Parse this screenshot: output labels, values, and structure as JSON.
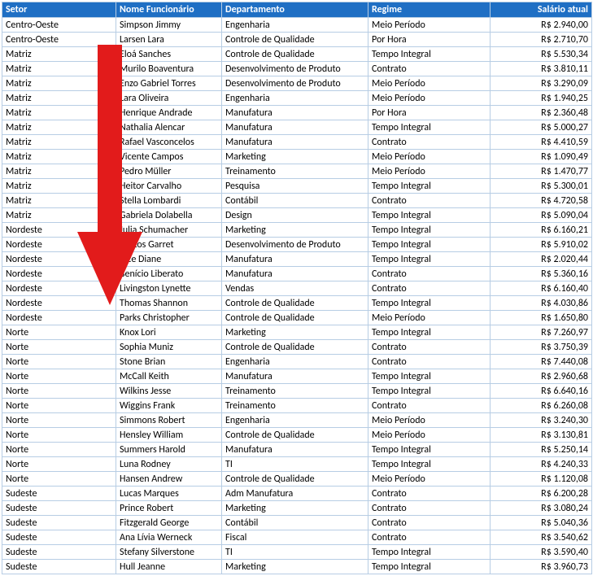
{
  "headers": {
    "setor": "Setor",
    "nome": "Nome Funcionário",
    "departamento": "Departamento",
    "regime": "Regime",
    "salario": "Salário atual"
  },
  "rows": [
    {
      "setor": "Centro-Oeste",
      "nome": "Simpson Jimmy",
      "departamento": "Engenharia",
      "regime": "Meio Período",
      "salario": "R$ 2.940,00"
    },
    {
      "setor": "Centro-Oeste",
      "nome": "Larsen Lara",
      "departamento": "Controle de Qualidade",
      "regime": "Por Hora",
      "salario": "R$ 2.710,70"
    },
    {
      "setor": "Matriz",
      "nome": "Eloá Sanches",
      "departamento": "Controle de Qualidade",
      "regime": "Tempo Integral",
      "salario": "R$ 5.530,34"
    },
    {
      "setor": "Matriz",
      "nome": "Murilo Boaventura",
      "departamento": "Desenvolvimento de Produto",
      "regime": "Contrato",
      "salario": "R$ 3.810,11"
    },
    {
      "setor": "Matriz",
      "nome": "Enzo Gabriel Torres",
      "departamento": "Desenvolvimento de Produto",
      "regime": "Meio Período",
      "salario": "R$ 3.290,09"
    },
    {
      "setor": "Matriz",
      "nome": "Lara Oliveira",
      "departamento": "Engenharia",
      "regime": "Meio Período",
      "salario": "R$ 1.940,25"
    },
    {
      "setor": "Matriz",
      "nome": "Henrique Andrade",
      "departamento": "Manufatura",
      "regime": "Por Hora",
      "salario": "R$ 2.360,48"
    },
    {
      "setor": "Matriz",
      "nome": "Nathalia Alencar",
      "departamento": "Manufatura",
      "regime": "Tempo Integral",
      "salario": "R$ 5.000,27"
    },
    {
      "setor": "Matriz",
      "nome": "Rafael Vasconcelos",
      "departamento": "Manufatura",
      "regime": "Contrato",
      "salario": "R$ 4.410,59"
    },
    {
      "setor": "Matriz",
      "nome": "Vicente Campos",
      "departamento": "Marketing",
      "regime": "Meio Período",
      "salario": "R$ 1.090,49"
    },
    {
      "setor": "Matriz",
      "nome": "Pedro Müller",
      "departamento": "Treinamento",
      "regime": "Meio Período",
      "salario": "R$ 1.470,77"
    },
    {
      "setor": "Matriz",
      "nome": "Heitor Carvalho",
      "departamento": "Pesquisa",
      "regime": "Tempo Integral",
      "salario": "R$ 5.300,01"
    },
    {
      "setor": "Matriz",
      "nome": "Stella Lombardi",
      "departamento": "Contábil",
      "regime": "Contrato",
      "salario": "R$ 4.720,58"
    },
    {
      "setor": "Matriz",
      "nome": "Gabriela Dolabella",
      "departamento": "Design",
      "regime": "Tempo Integral",
      "salario": "R$ 5.090,04"
    },
    {
      "setor": "Nordeste",
      "nome": "Julia Schumacher",
      "departamento": "Marketing",
      "regime": "Tempo Integral",
      "salario": "R$ 6.160,21"
    },
    {
      "setor": "Nordeste",
      "nome": "Santos Garret",
      "departamento": "Desenvolvimento de Produto",
      "regime": "Tempo Integral",
      "salario": "R$ 5.910,02"
    },
    {
      "setor": "Nordeste",
      "nome": "Rice Diane",
      "departamento": "Manufatura",
      "regime": "Tempo Integral",
      "salario": "R$ 2.020,44"
    },
    {
      "setor": "Nordeste",
      "nome": "Benício Liberato",
      "departamento": "Manufatura",
      "regime": "Contrato",
      "salario": "R$ 5.360,16"
    },
    {
      "setor": "Nordeste",
      "nome": "Livingston Lynette",
      "departamento": "Vendas",
      "regime": "Contrato",
      "salario": "R$ 6.160,40"
    },
    {
      "setor": "Nordeste",
      "nome": "Thomas Shannon",
      "departamento": "Controle de Qualidade",
      "regime": "Tempo Integral",
      "salario": "R$ 4.030,86"
    },
    {
      "setor": "Nordeste",
      "nome": "Parks Christopher",
      "departamento": "Controle de Qualidade",
      "regime": "Meio Período",
      "salario": "R$ 1.650,80"
    },
    {
      "setor": "Norte",
      "nome": "Knox Lori",
      "departamento": "Marketing",
      "regime": "Tempo Integral",
      "salario": "R$ 7.260,97"
    },
    {
      "setor": "Norte",
      "nome": "Sophia Muniz",
      "departamento": "Controle de Qualidade",
      "regime": "Contrato",
      "salario": "R$ 3.750,39"
    },
    {
      "setor": "Norte",
      "nome": "Stone Brian",
      "departamento": "Engenharia",
      "regime": "Contrato",
      "salario": "R$ 7.440,08"
    },
    {
      "setor": "Norte",
      "nome": "McCall Keith",
      "departamento": "Manufatura",
      "regime": "Tempo Integral",
      "salario": "R$ 2.960,68"
    },
    {
      "setor": "Norte",
      "nome": "Wilkins Jesse",
      "departamento": "Treinamento",
      "regime": "Tempo Integral",
      "salario": "R$ 6.640,16"
    },
    {
      "setor": "Norte",
      "nome": "Wiggins Frank",
      "departamento": "Treinamento",
      "regime": "Contrato",
      "salario": "R$ 6.260,08"
    },
    {
      "setor": "Norte",
      "nome": "Simmons Robert",
      "departamento": "Engenharia",
      "regime": "Meio Período",
      "salario": "R$ 3.240,30"
    },
    {
      "setor": "Norte",
      "nome": "Hensley William",
      "departamento": "Controle de Qualidade",
      "regime": "Meio Período",
      "salario": "R$ 3.130,81"
    },
    {
      "setor": "Norte",
      "nome": "Summers Harold",
      "departamento": "Manufatura",
      "regime": "Tempo Integral",
      "salario": "R$ 5.250,14"
    },
    {
      "setor": "Norte",
      "nome": "Luna Rodney",
      "departamento": "TI",
      "regime": "Tempo Integral",
      "salario": "R$ 4.240,33"
    },
    {
      "setor": "Norte",
      "nome": "Hansen Andrew",
      "departamento": "Controle de Qualidade",
      "regime": "Meio Período",
      "salario": "R$ 1.120,08"
    },
    {
      "setor": "Sudeste",
      "nome": "Lucas Marques",
      "departamento": "Adm Manufatura",
      "regime": "Contrato",
      "salario": "R$ 6.200,28"
    },
    {
      "setor": "Sudeste",
      "nome": "Prince Robert",
      "departamento": "Marketing",
      "regime": "Contrato",
      "salario": "R$ 3.080,24"
    },
    {
      "setor": "Sudeste",
      "nome": "Fitzgerald George",
      "departamento": "Contábil",
      "regime": "Contrato",
      "salario": "R$ 5.040,36"
    },
    {
      "setor": "Sudeste",
      "nome": "Ana Lívia Werneck",
      "departamento": "Fiscal",
      "regime": "Contrato",
      "salario": "R$ 3.540,62"
    },
    {
      "setor": "Sudeste",
      "nome": "Stefany Silverstone",
      "departamento": "TI",
      "regime": "Tempo Integral",
      "salario": "R$ 3.590,40"
    },
    {
      "setor": "Sudeste",
      "nome": "Hull Jeanne",
      "departamento": "Marketing",
      "regime": "Tempo Integral",
      "salario": "R$ 3.960,73"
    }
  ]
}
